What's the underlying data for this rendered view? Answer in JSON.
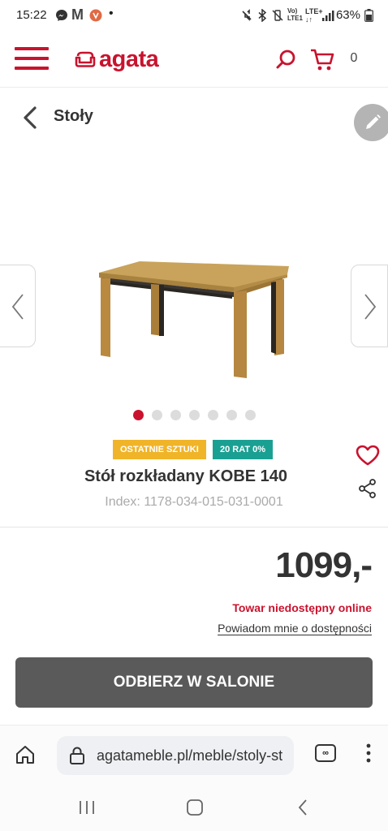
{
  "status_bar": {
    "time": "15:22",
    "notification_icons": [
      "messenger-icon",
      "gmail-icon",
      "vivaldi-icon"
    ],
    "dot": "•",
    "network": "LTE+",
    "battery": "63%"
  },
  "header": {
    "logo_text": "agata",
    "cart_count": "0",
    "brand_color": "#c9132e"
  },
  "breadcrumb": {
    "label": "Stoły"
  },
  "gallery": {
    "total_images": 7,
    "active_index": 0
  },
  "product": {
    "badges": [
      {
        "label": "OSTATNIE SZTUKI",
        "color": "#f0b428"
      },
      {
        "label": "20 RAT 0%",
        "color": "#1aa093"
      }
    ],
    "title": "Stół rozkładany KOBE 140",
    "index_text": "Index: 1178-034-015-031-0001",
    "price": "1099,-",
    "availability": "Towar niedostępny online",
    "notify_link": "Powiadom mnie o dostępności",
    "cta_label": "ODBIERZ W SALONIE"
  },
  "browser": {
    "url": "agatameble.pl/meble/stoly-st",
    "tabs_icon_label": "∞"
  }
}
